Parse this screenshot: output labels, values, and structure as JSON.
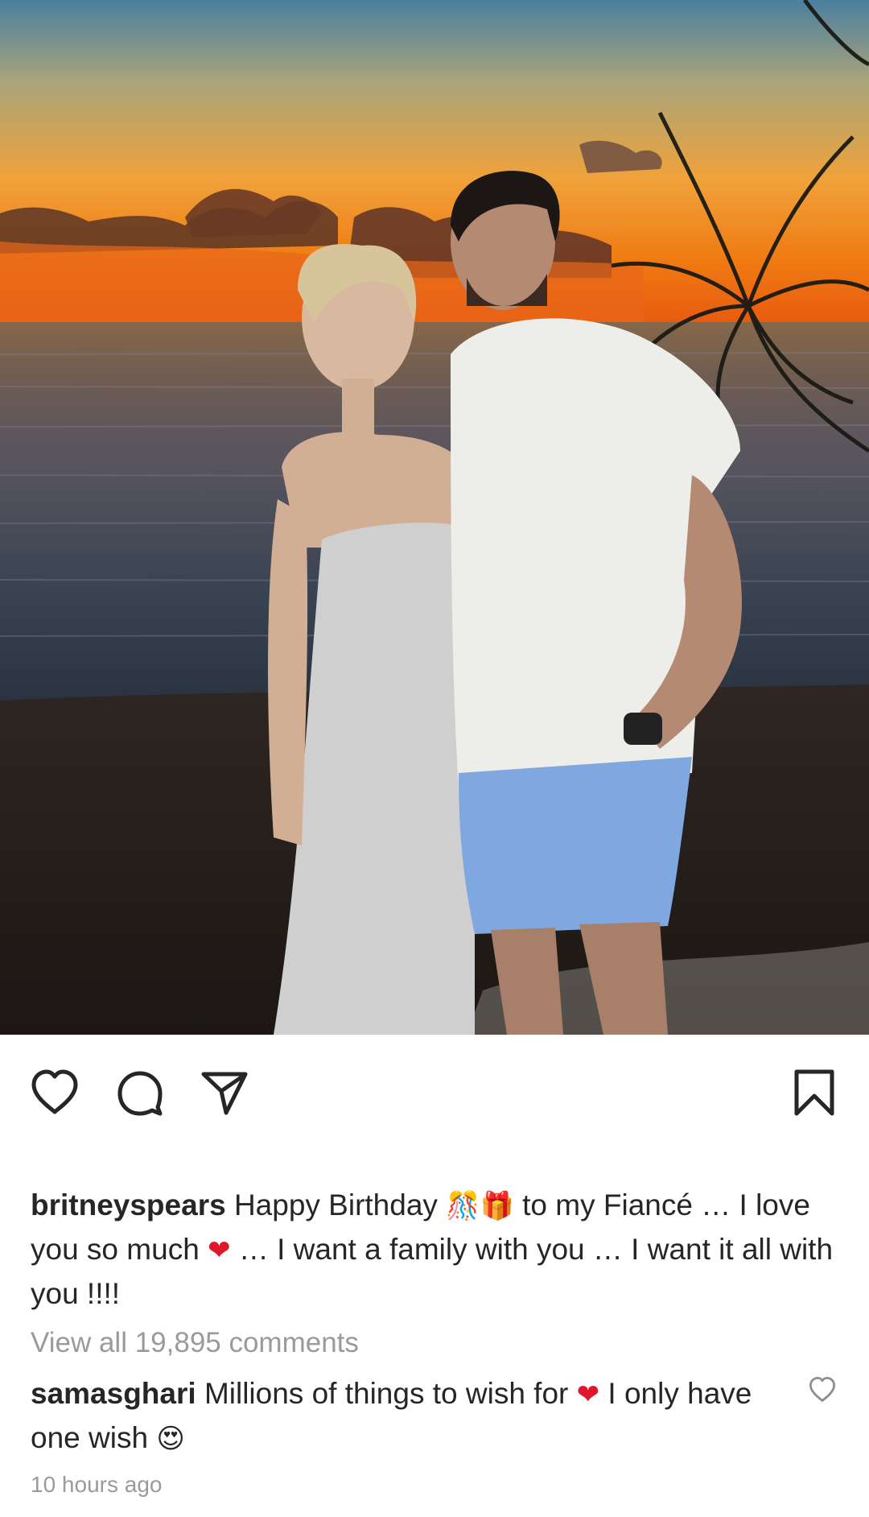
{
  "post": {
    "image_alt": "Couple posing on a beach at sunset",
    "icons": {
      "like": "heart-outline-icon",
      "comment": "comment-bubble-icon",
      "share": "paper-plane-icon",
      "save": "bookmark-icon"
    }
  },
  "caption": {
    "username": "britneyspears",
    "text_part1": " Happy Birthday ",
    "emoji1": "🎊🎁",
    "text_part2": " to my Fiancé … I love you so much ",
    "emoji2": "❤",
    "text_part3": " … I want a family with you …  I want it all with you !!!!"
  },
  "view_comments_label": "View all 19,895 comments",
  "top_comment": {
    "username": "samasghari",
    "text_part1": " Millions of things to wish for ",
    "emoji1": "❤",
    "text_part2": " I only have one wish ",
    "emoji2": "😍",
    "like_icon": "small-heart-outline-icon"
  },
  "timestamp": "10 hours ago",
  "colors": {
    "text": "#262626",
    "muted": "#9a9a9a",
    "heart_red": "#e0162b"
  }
}
